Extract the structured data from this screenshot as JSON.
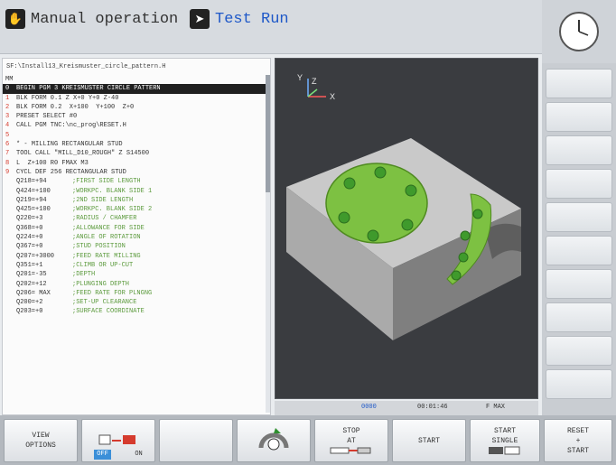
{
  "header": {
    "mode_primary": "Manual operation",
    "mode_secondary": "Test Run"
  },
  "program": {
    "path": "SF:\\Install13_Kreismuster_circle_pattern.H",
    "unit": "MM",
    "lines": [
      {
        "n": "0",
        "code": "BEGIN PGM 3 KREISMUSTER CIRCLE PATTERN",
        "hl": true
      },
      {
        "n": "1",
        "code": "BLK FORM 0.1 Z X+0 Y+0 Z-40"
      },
      {
        "n": "2",
        "code": "BLK FORM 0.2  X+100  Y+100  Z+0"
      },
      {
        "n": "3",
        "code": "PRESET SELECT #0"
      },
      {
        "n": "4",
        "code": "CALL PGM TNC:\\nc_prog\\RESET.H"
      },
      {
        "n": "5",
        "code": ""
      },
      {
        "n": "6",
        "code": "* - MILLING RECTANGULAR STUD"
      },
      {
        "n": "7",
        "code": "TOOL CALL \"MILL_D10_ROUGH\" Z S14500"
      },
      {
        "n": "8",
        "code": "L  Z+100 R0 FMAX M3"
      },
      {
        "n": "9",
        "code": "CYCL DEF 256 RECTANGULAR STUD"
      }
    ],
    "params": [
      {
        "p": "Q218=+94",
        "c": ";FIRST SIDE LENGTH"
      },
      {
        "p": "Q424=+100",
        "c": ";WORKPC. BLANK SIDE 1"
      },
      {
        "p": "Q219=+94",
        "c": ";2ND SIDE LENGTH"
      },
      {
        "p": "Q425=+100",
        "c": ";WORKPC. BLANK SIDE 2"
      },
      {
        "p": "Q220=+3",
        "c": ";RADIUS / CHAMFER"
      },
      {
        "p": "Q368=+0",
        "c": ";ALLOWANCE FOR SIDE"
      },
      {
        "p": "Q224=+0",
        "c": ";ANGLE OF ROTATION"
      },
      {
        "p": "Q367=+0",
        "c": ";STUD POSITION"
      },
      {
        "p": "Q207=+3000",
        "c": ";FEED RATE MILLING"
      },
      {
        "p": "Q351=+1",
        "c": ";CLIMB OR UP-CUT"
      },
      {
        "p": "Q201=-35",
        "c": ";DEPTH"
      },
      {
        "p": "Q202=+12",
        "c": ";PLUNGING DEPTH"
      },
      {
        "p": "Q206= MAX",
        "c": ";FEED RATE FOR PLNGNG"
      },
      {
        "p": "Q200=+2",
        "c": ";SET-UP CLEARANCE"
      },
      {
        "p": "Q203=+0",
        "c": ";SURFACE COORDINATE"
      }
    ]
  },
  "view": {
    "axis_y": "Y",
    "axis_z": "Z",
    "axis_x": "X"
  },
  "status": {
    "left": "",
    "mid": "0000",
    "time": "00:01:46",
    "feed": "F MAX"
  },
  "softkeys": {
    "view_options_1": "VIEW",
    "view_options_2": "OPTIONS",
    "toggle_off": "OFF",
    "toggle_on": "ON",
    "stop_at_1": "STOP",
    "stop_at_2": "AT",
    "start": "START",
    "start_single_1": "START",
    "start_single_2": "SINGLE",
    "reset_start_1": "RESET",
    "reset_start_2": "+",
    "reset_start_3": "START"
  },
  "colors": {
    "accent_blue": "#1e58c8",
    "part_green": "#7dc142",
    "program_line_number": "#d53b2e"
  }
}
